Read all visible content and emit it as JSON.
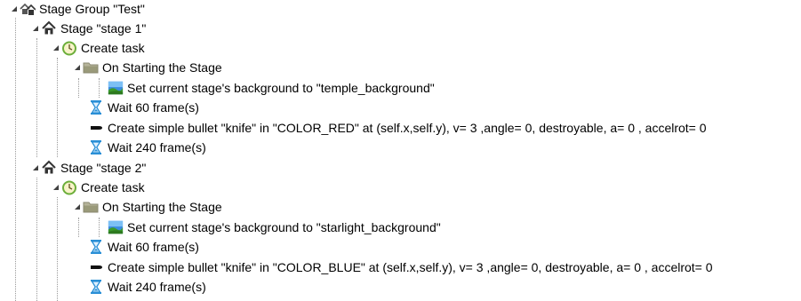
{
  "tree": {
    "group": {
      "label": "Stage Group \"Test\"",
      "icon": "stage-group-icon",
      "expanded": true
    },
    "stages": [
      {
        "label": "Stage \"stage 1\"",
        "icon": "home-icon",
        "task": {
          "label": "Create task",
          "icon": "clock-icon"
        },
        "on_start": {
          "label": "On Starting the Stage",
          "icon": "folder-icon"
        },
        "set_background": {
          "label": "Set current stage's background to \"temple_background\"",
          "icon": "landscape-image-icon"
        },
        "wait_1": {
          "label": "Wait 60 frame(s)",
          "icon": "hourglass-icon"
        },
        "bullet": {
          "label": "Create simple bullet \"knife\" in \"COLOR_RED\" at (self.x,self.y), v= 3 ,angle= 0, destroyable, a= 0 , accelrot= 0",
          "icon": "bullet-icon"
        },
        "wait_2": {
          "label": "Wait 240 frame(s)",
          "icon": "hourglass-icon"
        }
      },
      {
        "label": "Stage \"stage 2\"",
        "icon": "home-icon",
        "task": {
          "label": "Create task",
          "icon": "clock-icon"
        },
        "on_start": {
          "label": "On Starting the Stage",
          "icon": "folder-icon"
        },
        "set_background": {
          "label": "Set current stage's background to \"starlight_background\"",
          "icon": "landscape-image-icon"
        },
        "wait_1": {
          "label": "Wait 60 frame(s)",
          "icon": "hourglass-icon"
        },
        "bullet": {
          "label": "Create simple bullet \"knife\" in \"COLOR_BLUE\" at (self.x,self.y), v= 3 ,angle= 0, destroyable, a= 0 , accelrot= 0",
          "icon": "bullet-icon"
        },
        "wait_2": {
          "label": "Wait 240 frame(s)",
          "icon": "hourglass-icon"
        }
      }
    ]
  },
  "colors": {
    "guide": "#9a9a9a",
    "expander": "#404040",
    "hourglass": "#2a8fd6",
    "clock": "#6cae3a",
    "folder": "#9a9a7a"
  }
}
